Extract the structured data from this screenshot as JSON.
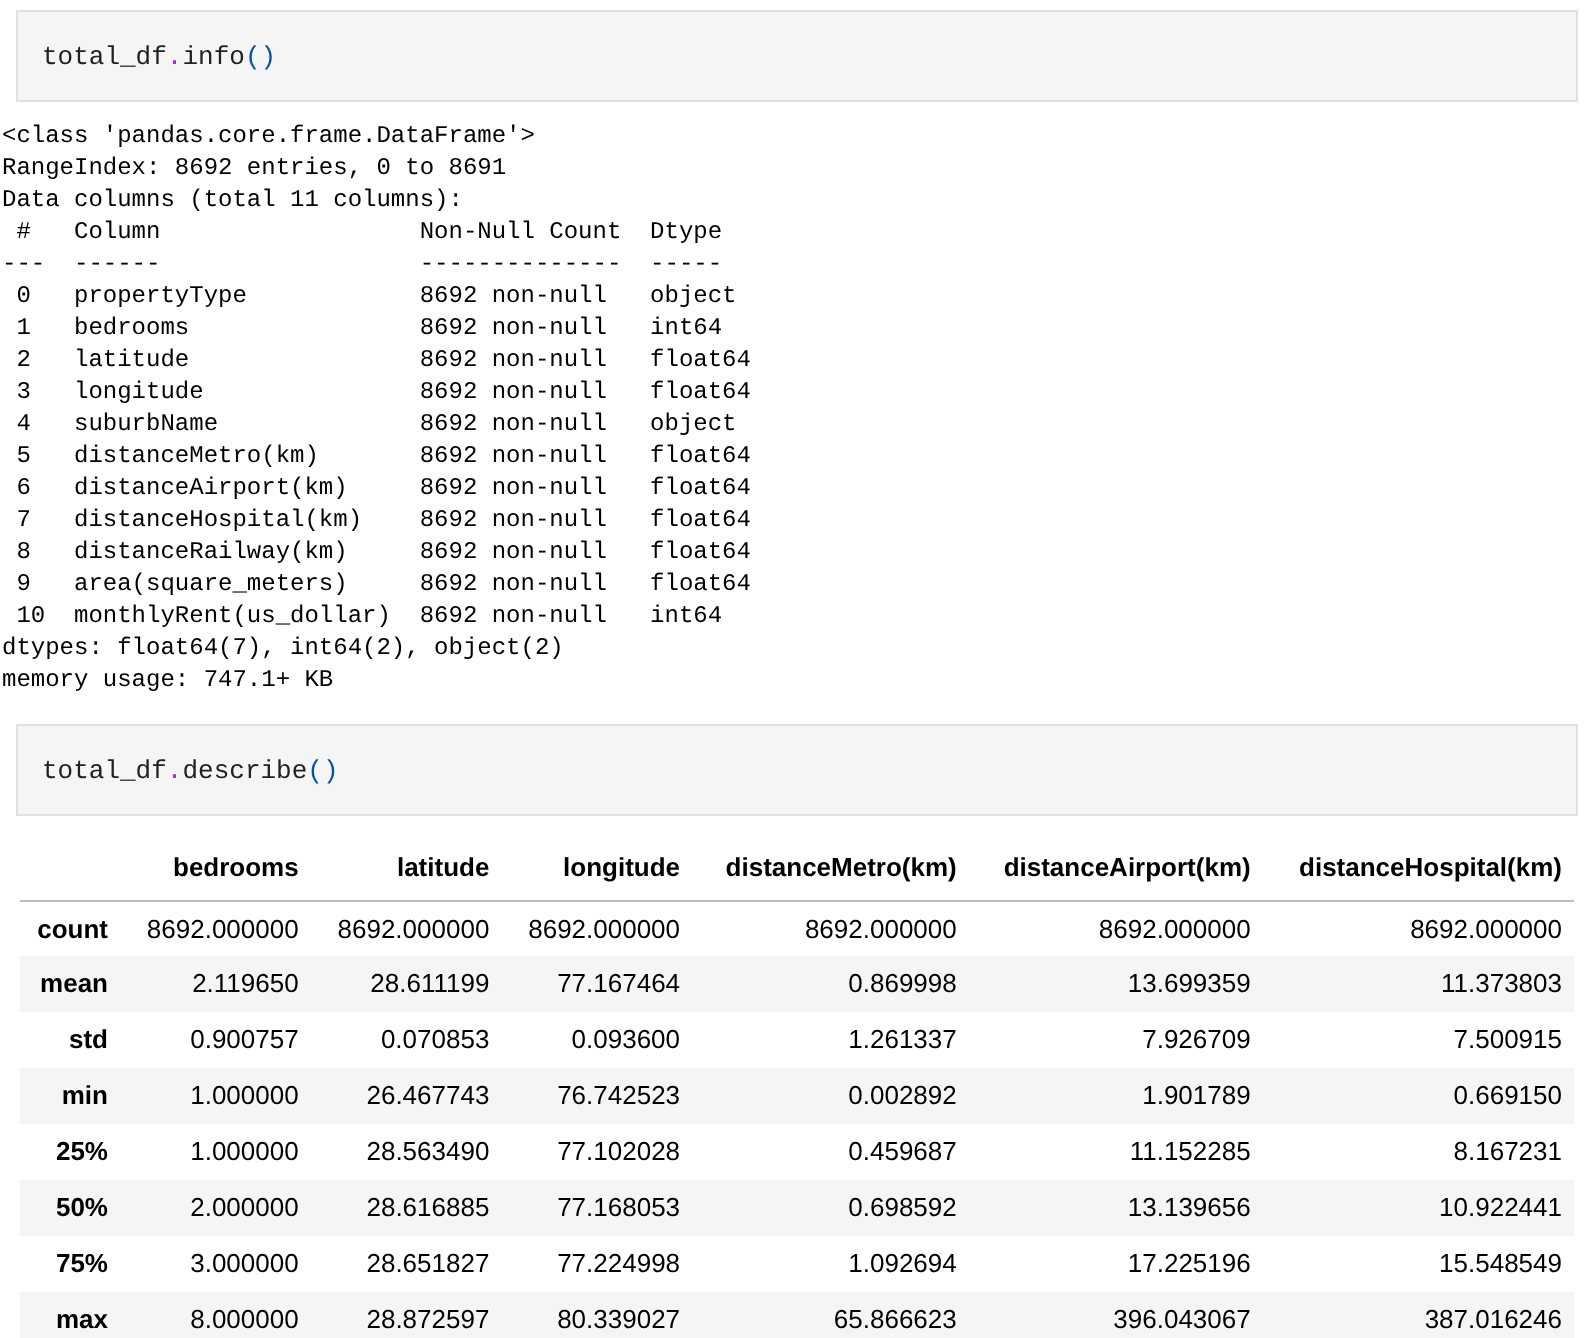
{
  "cells": [
    {
      "code": [
        {
          "kind": "name",
          "text": "total_df"
        },
        {
          "kind": "op",
          "text": "."
        },
        {
          "kind": "name",
          "text": "info"
        },
        {
          "kind": "paren",
          "text": "()"
        }
      ],
      "output": {
        "kind": "text",
        "lines": [
          "<class 'pandas.core.frame.DataFrame'>",
          "RangeIndex: 8692 entries, 0 to 8691",
          "Data columns (total 11 columns):",
          " #   Column                  Non-Null Count  Dtype  ",
          "---  ------                  --------------  -----  ",
          " 0   propertyType            8692 non-null   object ",
          " 1   bedrooms                8692 non-null   int64  ",
          " 2   latitude                8692 non-null   float64",
          " 3   longitude               8692 non-null   float64",
          " 4   suburbName              8692 non-null   object ",
          " 5   distanceMetro(km)       8692 non-null   float64",
          " 6   distanceAirport(km)     8692 non-null   float64",
          " 7   distanceHospital(km)    8692 non-null   float64",
          " 8   distanceRailway(km)     8692 non-null   float64",
          " 9   area(square_meters)     8692 non-null   float64",
          " 10  monthlyRent(us_dollar)  8692 non-null   int64  ",
          "dtypes: float64(7), int64(2), object(2)",
          "memory usage: 747.1+ KB"
        ]
      }
    },
    {
      "code": [
        {
          "kind": "name",
          "text": "total_df"
        },
        {
          "kind": "op",
          "text": "."
        },
        {
          "kind": "name",
          "text": "describe"
        },
        {
          "kind": "paren",
          "text": "()"
        }
      ],
      "output": {
        "kind": "table",
        "columns": [
          "bedrooms",
          "latitude",
          "longitude",
          "distanceMetro(km)",
          "distanceAirport(km)",
          "distanceHospital(km)"
        ],
        "rows": [
          {
            "label": "count",
            "values": [
              "8692.000000",
              "8692.000000",
              "8692.000000",
              "8692.000000",
              "8692.000000",
              "8692.000000"
            ]
          },
          {
            "label": "mean",
            "values": [
              "2.119650",
              "28.611199",
              "77.167464",
              "0.869998",
              "13.699359",
              "11.373803"
            ]
          },
          {
            "label": "std",
            "values": [
              "0.900757",
              "0.070853",
              "0.093600",
              "1.261337",
              "7.926709",
              "7.500915"
            ]
          },
          {
            "label": "min",
            "values": [
              "1.000000",
              "26.467743",
              "76.742523",
              "0.002892",
              "1.901789",
              "0.669150"
            ]
          },
          {
            "label": "25%",
            "values": [
              "1.000000",
              "28.563490",
              "77.102028",
              "0.459687",
              "11.152285",
              "8.167231"
            ]
          },
          {
            "label": "50%",
            "values": [
              "2.000000",
              "28.616885",
              "77.168053",
              "0.698592",
              "13.139656",
              "10.922441"
            ]
          },
          {
            "label": "75%",
            "values": [
              "3.000000",
              "28.651827",
              "77.224998",
              "1.092694",
              "17.225196",
              "15.548549"
            ]
          },
          {
            "label": "max",
            "values": [
              "8.000000",
              "28.872597",
              "80.339027",
              "65.866623",
              "396.043067",
              "387.016246"
            ]
          }
        ]
      }
    }
  ]
}
